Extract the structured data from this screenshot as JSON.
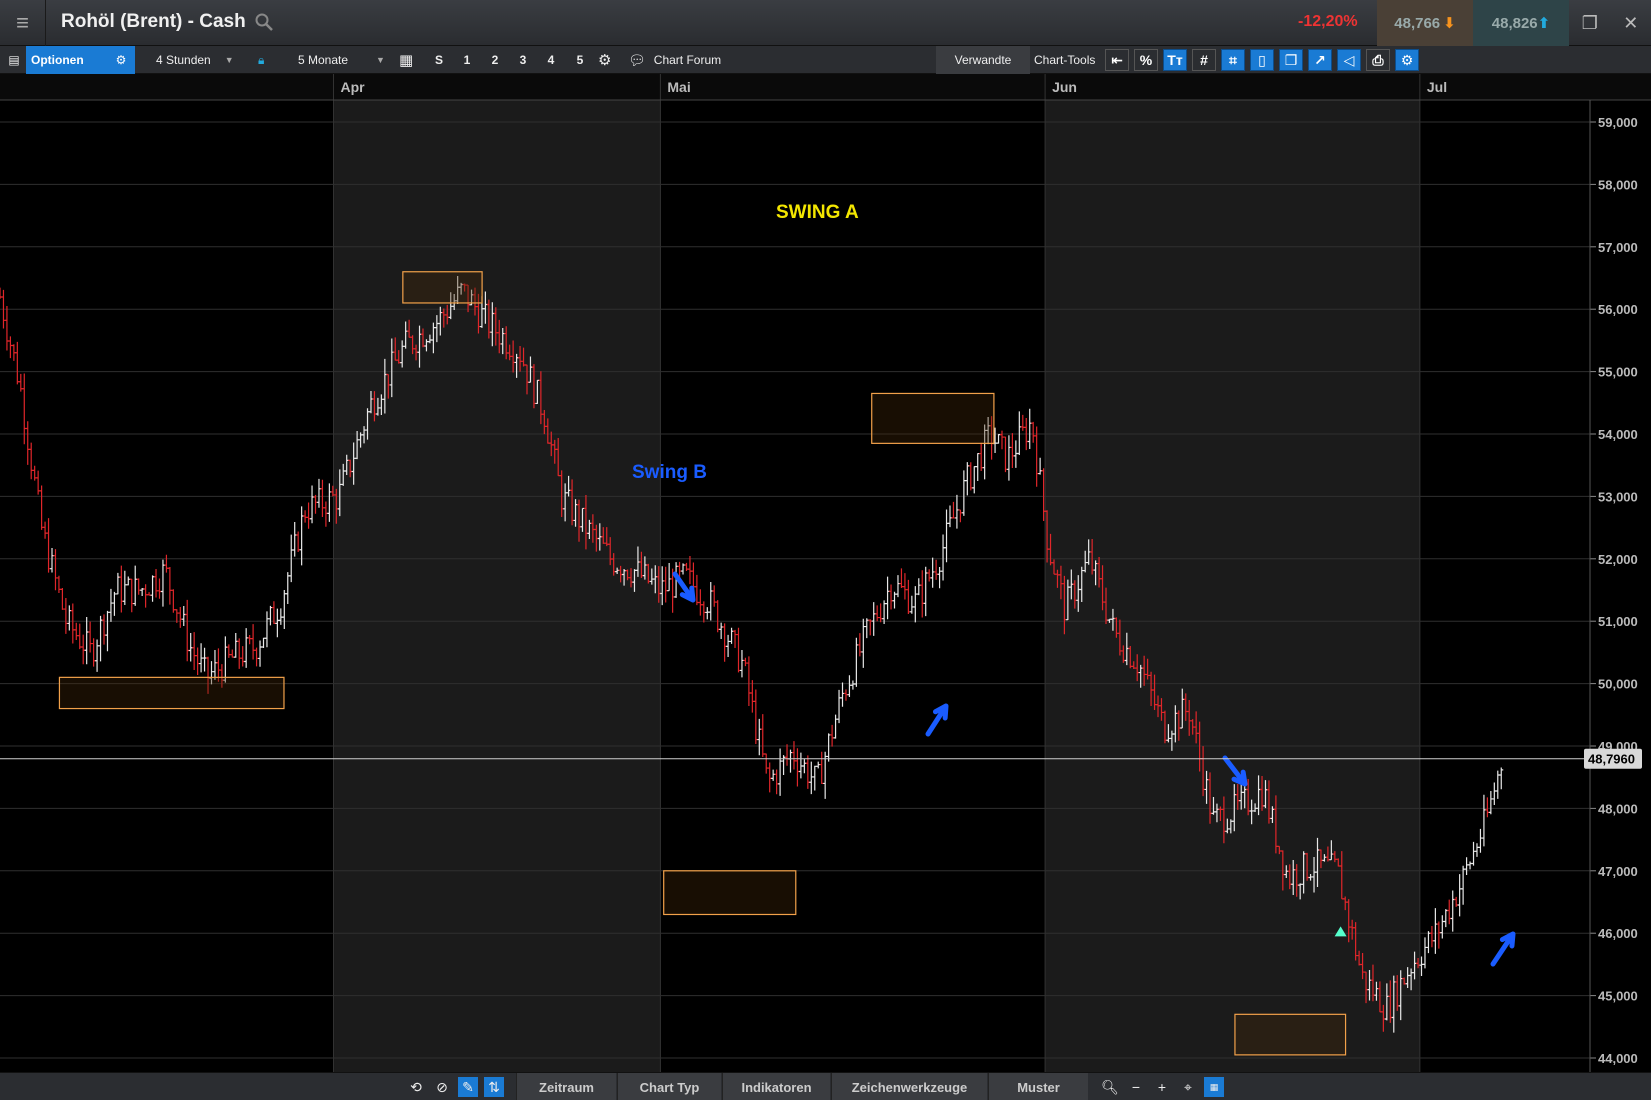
{
  "window": {
    "title": "Rohöl (Brent) - Cash",
    "change": "-12,20%",
    "bid": "48,766",
    "ask": "48,826"
  },
  "toolbar": {
    "options_label": "Optionen",
    "interval": "4 Stunden",
    "range": "5 Monate",
    "presets": [
      "S",
      "1",
      "2",
      "3",
      "4",
      "5"
    ],
    "chart_forum": "Chart Forum",
    "related": "Verwandte",
    "chart_tools": "Chart-Tools"
  },
  "bottombar": {
    "tabs": [
      "Zeitraum",
      "Chart Typ",
      "Indikatoren",
      "Zeichenwerkzeuge",
      "Muster"
    ]
  },
  "colors": {
    "up": "#e8e8e8",
    "down": "#e0262a",
    "accent": "#1a7bd4",
    "box": "#f2a14a",
    "annotation_blue": "#1a5cff",
    "annotation_yellow": "#f3e600"
  },
  "chart_data": {
    "type": "bar",
    "series_style": "ohlc",
    "x_labels": [
      "Apr",
      "Mai",
      "Jun",
      "Jul"
    ],
    "ylim": [
      44000,
      59000
    ],
    "y_ticks": [
      "59,000",
      "58,000",
      "57,000",
      "56,000",
      "55,000",
      "54,000",
      "53,000",
      "52,000",
      "51,000",
      "50,000",
      "49,000",
      "48,000",
      "47,000",
      "46,000",
      "45,000",
      "44,000"
    ],
    "current_price": 48796,
    "current_price_label": "48,7960",
    "grid": true,
    "annotations": [
      {
        "text": "SWING A"
      },
      {
        "text": "Swing B"
      }
    ],
    "path": [
      {
        "x": 0.0,
        "y": 56200
      },
      {
        "x": 1.2,
        "y": 54800
      },
      {
        "x": 2.5,
        "y": 52500
      },
      {
        "x": 4.0,
        "y": 51000
      },
      {
        "x": 5.5,
        "y": 50500
      },
      {
        "x": 7.0,
        "y": 51500
      },
      {
        "x": 8.5,
        "y": 51500
      },
      {
        "x": 10.0,
        "y": 51800
      },
      {
        "x": 11.5,
        "y": 50600
      },
      {
        "x": 12.5,
        "y": 50100
      },
      {
        "x": 14.0,
        "y": 50400
      },
      {
        "x": 15.5,
        "y": 50600
      },
      {
        "x": 17.0,
        "y": 51300
      },
      {
        "x": 18.5,
        "y": 52800
      },
      {
        "x": 20.5,
        "y": 53000
      },
      {
        "x": 22.5,
        "y": 54500
      },
      {
        "x": 24.5,
        "y": 55400
      },
      {
        "x": 26.5,
        "y": 55800
      },
      {
        "x": 28.0,
        "y": 56300
      },
      {
        "x": 29.5,
        "y": 55800
      },
      {
        "x": 31.5,
        "y": 55300
      },
      {
        "x": 33.0,
        "y": 54300
      },
      {
        "x": 34.0,
        "y": 53000
      },
      {
        "x": 35.5,
        "y": 52500
      },
      {
        "x": 37.0,
        "y": 52000
      },
      {
        "x": 38.5,
        "y": 51800
      },
      {
        "x": 40.0,
        "y": 51500
      },
      {
        "x": 41.5,
        "y": 51700
      },
      {
        "x": 43.0,
        "y": 51300
      },
      {
        "x": 45.0,
        "y": 50300
      },
      {
        "x": 46.5,
        "y": 48400
      },
      {
        "x": 48.0,
        "y": 48900
      },
      {
        "x": 49.5,
        "y": 48400
      },
      {
        "x": 51.0,
        "y": 49800
      },
      {
        "x": 52.5,
        "y": 50800
      },
      {
        "x": 54.0,
        "y": 51600
      },
      {
        "x": 55.5,
        "y": 51300
      },
      {
        "x": 57.0,
        "y": 52100
      },
      {
        "x": 58.5,
        "y": 53200
      },
      {
        "x": 60.0,
        "y": 54000
      },
      {
        "x": 61.0,
        "y": 53600
      },
      {
        "x": 62.5,
        "y": 54200
      },
      {
        "x": 63.5,
        "y": 52200
      },
      {
        "x": 64.5,
        "y": 51200
      },
      {
        "x": 66.0,
        "y": 52000
      },
      {
        "x": 67.5,
        "y": 50800
      },
      {
        "x": 69.0,
        "y": 50300
      },
      {
        "x": 70.5,
        "y": 49300
      },
      {
        "x": 72.0,
        "y": 49600
      },
      {
        "x": 73.5,
        "y": 47800
      },
      {
        "x": 75.0,
        "y": 48000
      },
      {
        "x": 76.5,
        "y": 48300
      },
      {
        "x": 78.0,
        "y": 46900
      },
      {
        "x": 79.5,
        "y": 47100
      },
      {
        "x": 81.0,
        "y": 47000
      },
      {
        "x": 82.5,
        "y": 45300
      },
      {
        "x": 84.0,
        "y": 44800
      },
      {
        "x": 85.5,
        "y": 45500
      },
      {
        "x": 87.0,
        "y": 46000
      },
      {
        "x": 88.5,
        "y": 46800
      },
      {
        "x": 90.0,
        "y": 47800
      },
      {
        "x": 91.0,
        "y": 48800
      }
    ]
  }
}
